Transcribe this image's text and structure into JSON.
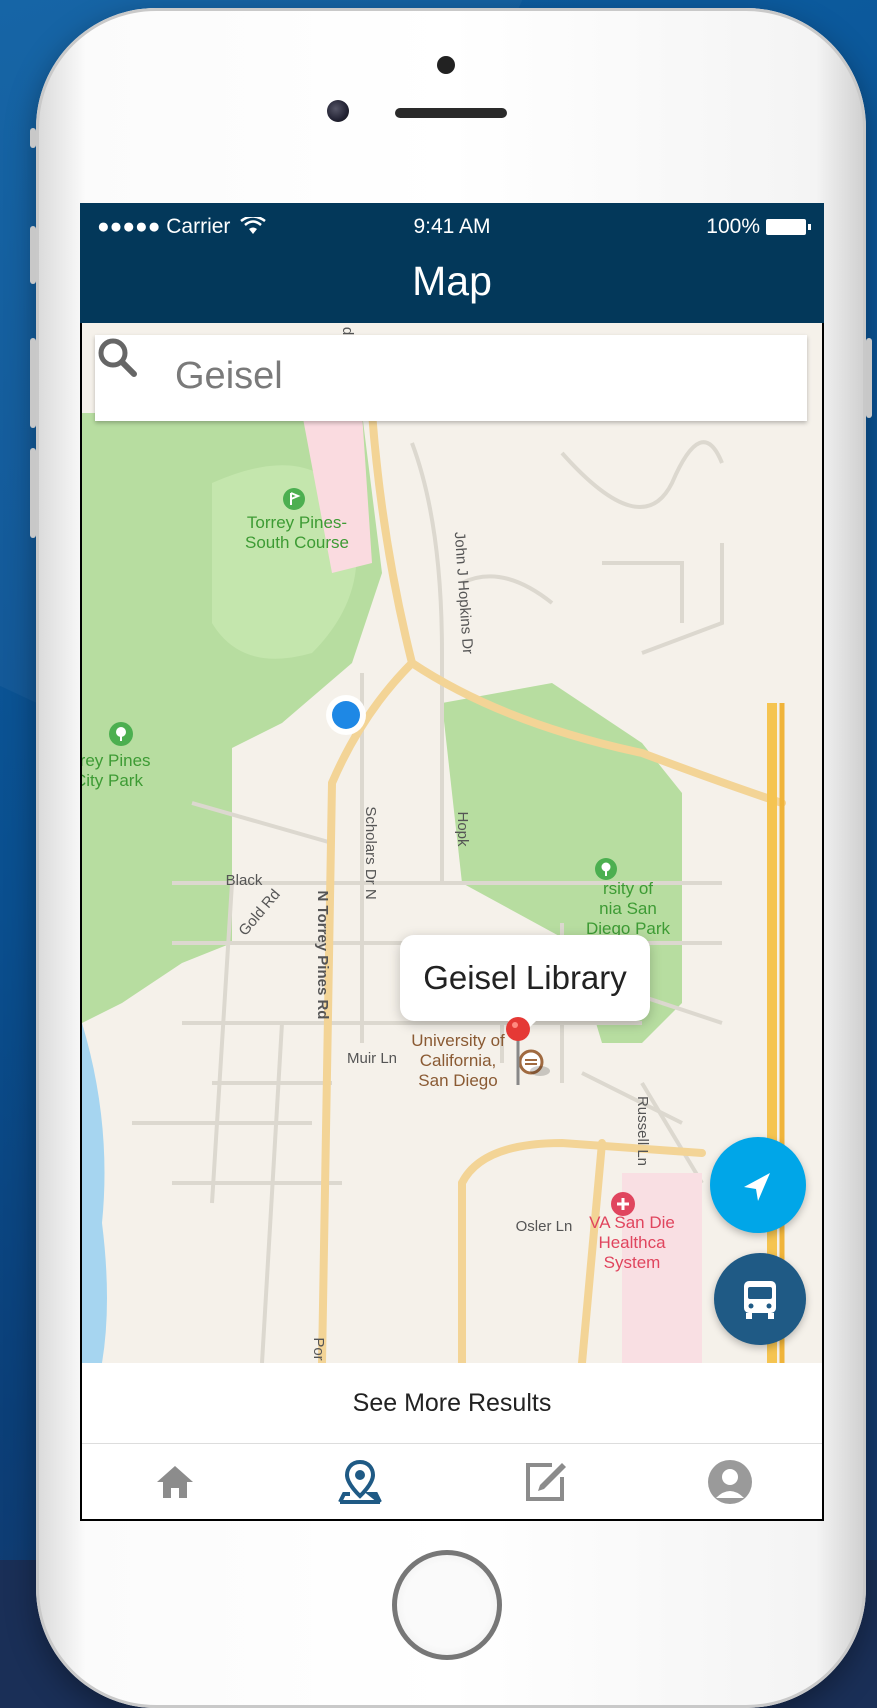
{
  "status_bar": {
    "carrier": "●●●●● Carrier",
    "time": "9:41 AM",
    "battery": "100%"
  },
  "nav": {
    "title": "Map"
  },
  "search": {
    "value": "Geisel",
    "icon": "search-icon"
  },
  "map": {
    "labels": {
      "torrey_golf_line1": "Torrey Pines-",
      "torrey_golf_line2": "South Course",
      "city_park_line1": "rrey Pines",
      "city_park_line2": "City Park",
      "ucsd_park_line1": "rsity of",
      "ucsd_park_line2": "nia San",
      "ucsd_park_line3": "Diego Park",
      "ucsd_line1": "University of",
      "ucsd_line2": "California,",
      "ucsd_line3": "San Diego",
      "va_line1": "VA San Die",
      "va_line2": "Healthca",
      "va_line3": "System",
      "road_john_hopkins": "John J Hopkins Dr",
      "road_n_torrey": "N Torrey Pines Rd",
      "road_scholars": "Scholars Dr N",
      "road_hopkins2": "Hopk",
      "road_black": "Black",
      "road_gold": "Gold Rd",
      "road_muir": "Muir Ln",
      "road_russell": "Russell Ln",
      "road_osler": "Osler Ln",
      "road_por": "Por",
      "road_d": "d"
    },
    "callout": "Geisel Library",
    "pin_color": "#e53935",
    "user_location_color": "#1e88e5"
  },
  "buttons": {
    "locate_icon": "navigation-arrow-icon",
    "bus_icon": "bus-icon",
    "see_more": "See More Results"
  },
  "tabbar": {
    "items": [
      "home-icon",
      "map-pin-icon",
      "edit-icon",
      "profile-icon"
    ],
    "active": "map-pin-icon",
    "active_color": "#1f5a85"
  }
}
